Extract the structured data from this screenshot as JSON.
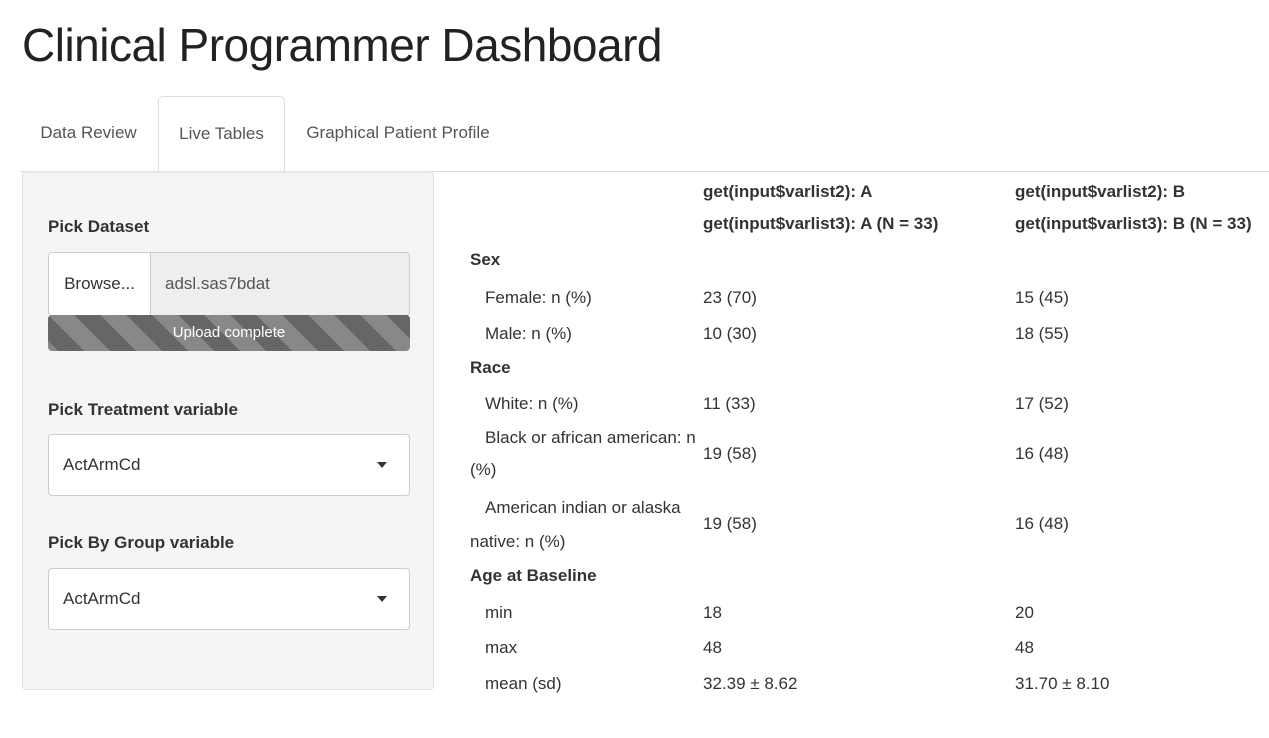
{
  "app": {
    "title": "Clinical Programmer Dashboard"
  },
  "tabs": [
    {
      "label": "Data Review",
      "active": false
    },
    {
      "label": "Live Tables",
      "active": true
    },
    {
      "label": "Graphical Patient Profile",
      "active": false
    }
  ],
  "sidebar": {
    "dataset": {
      "label": "Pick Dataset",
      "browse_label": "Browse...",
      "file_name": "adsl.sas7bdat",
      "progress_text": "Upload complete",
      "progress_value": 1.0
    },
    "treatment": {
      "label": "Pick Treatment variable",
      "value": "ActArmCd"
    },
    "by_group": {
      "label": "Pick By Group variable",
      "value": "ActArmCd"
    }
  },
  "table": {
    "columns": [
      {
        "line1": "get(input$varlist2): A",
        "line2": "get(input$varlist3): A (N = 33)"
      },
      {
        "line1": "get(input$varlist2): B",
        "line2": "get(input$varlist3): B (N = 33)"
      }
    ],
    "sections": {
      "sex": "Sex",
      "race": "Race",
      "age": "Age at Baseline"
    },
    "rows": {
      "female": {
        "label": "Female: n (%)",
        "a": "23 (70)",
        "b": "15 (45)"
      },
      "male": {
        "label": "Male: n (%)",
        "a": "10 (30)",
        "b": "18 (55)"
      },
      "white": {
        "label": "White: n (%)",
        "a": "11 (33)",
        "b": "17 (52)"
      },
      "black": {
        "label_line1": "Black or african american: n",
        "label_line2": "(%)",
        "a": "19 (58)",
        "b": "16 (48)"
      },
      "amind": {
        "label_line1": "American indian or alaska",
        "label_line2": "native: n (%)",
        "a": "19 (58)",
        "b": "16 (48)"
      },
      "min": {
        "label": "min",
        "a": "18",
        "b": "20"
      },
      "max": {
        "label": "max",
        "a": "48",
        "b": "48"
      },
      "mean": {
        "label": "mean (sd)",
        "a": "32.39 ± 8.62",
        "b": "31.70 ± 8.10"
      }
    }
  },
  "colors": {
    "progress_bar": "#666666",
    "sidebar_bg": "#f5f5f5",
    "border": "#cccccc"
  }
}
